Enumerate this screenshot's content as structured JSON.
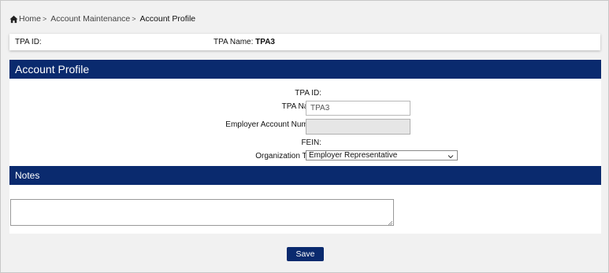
{
  "breadcrumb": {
    "home": "Home",
    "account_maintenance": "Account Maintenance",
    "current": "Account Profile",
    "separator": ">"
  },
  "infobar": {
    "tpa_id_label": "TPA ID:",
    "tpa_name_label": "TPA Name:",
    "tpa_name_value": "TPA3"
  },
  "profile": {
    "header": "Account Profile",
    "tpa_id_label": "TPA ID:",
    "tpa_name_label": "TPA Name:",
    "tpa_name_value": "TPA3",
    "employer_account_label": "Employer Account Number:",
    "employer_account_value": "",
    "fein_label": "FEIN:",
    "org_type_label": "Organization Type:",
    "org_type_value": "Employer Representative"
  },
  "notes": {
    "header": "Notes",
    "value": ""
  },
  "actions": {
    "save_label": "Save"
  },
  "colors": {
    "header_bg": "#0a2a6e",
    "page_bg": "#f1f1f1"
  },
  "icons": {
    "home": "home-icon",
    "dropdown": "chevron-down-icon"
  }
}
